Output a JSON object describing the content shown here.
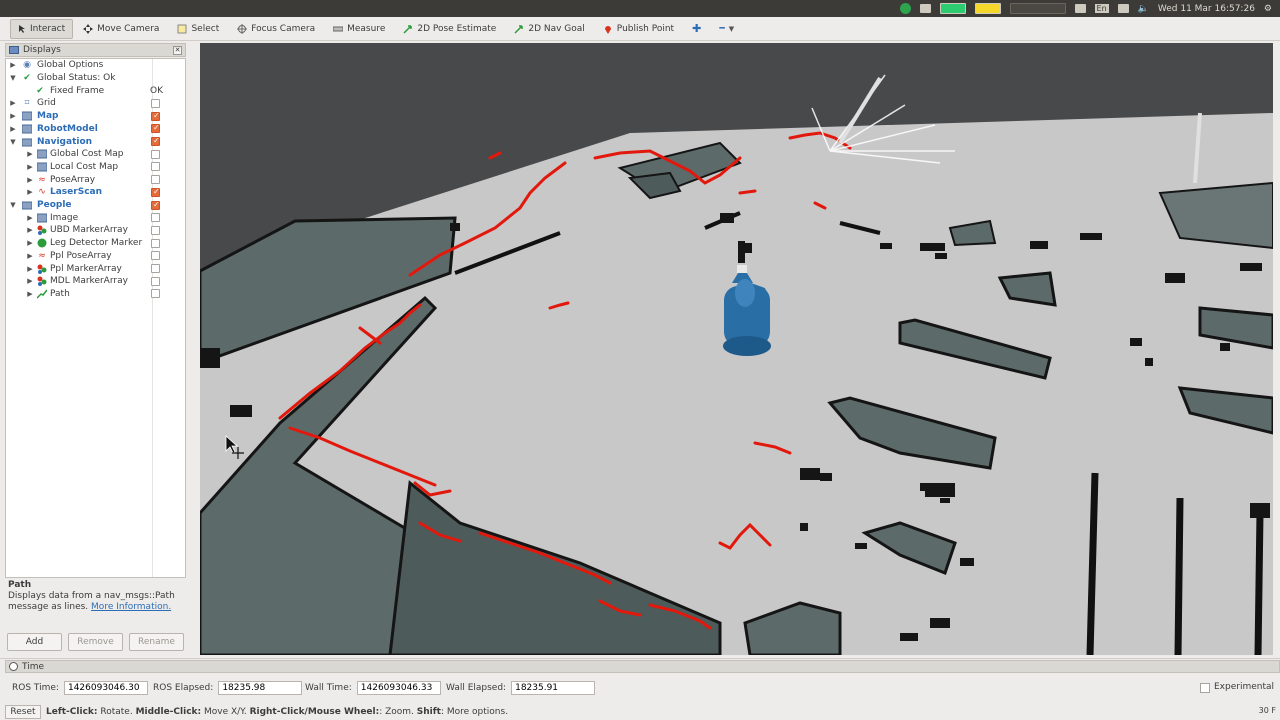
{
  "topbar": {
    "language": "En",
    "clock": "Wed 11 Mar 16:57:26"
  },
  "toolbar": {
    "tools": [
      {
        "label": "Interact",
        "icon": "interact-icon"
      },
      {
        "label": "Move Camera",
        "icon": "move-camera-icon"
      },
      {
        "label": "Select",
        "icon": "select-icon"
      },
      {
        "label": "Focus Camera",
        "icon": "focus-camera-icon"
      },
      {
        "label": "Measure",
        "icon": "measure-icon"
      },
      {
        "label": "2D Pose Estimate",
        "icon": "pose-estimate-icon"
      },
      {
        "label": "2D Nav Goal",
        "icon": "nav-goal-icon"
      },
      {
        "label": "Publish Point",
        "icon": "publish-point-icon"
      }
    ]
  },
  "displays": {
    "title": "Displays",
    "ok_label": "OK",
    "items": [
      {
        "label": "Global Options"
      },
      {
        "label": "Global Status: Ok"
      },
      {
        "label": "Fixed Frame"
      },
      {
        "label": "Grid",
        "checked": false
      },
      {
        "label": "Map",
        "checked": true
      },
      {
        "label": "RobotModel",
        "checked": true
      },
      {
        "label": "Navigation",
        "checked": true
      },
      {
        "label": "Global Cost Map",
        "checked": false
      },
      {
        "label": "Local Cost Map",
        "checked": false
      },
      {
        "label": "PoseArray",
        "checked": false
      },
      {
        "label": "LaserScan",
        "checked": true
      },
      {
        "label": "People",
        "checked": true
      },
      {
        "label": "Image",
        "checked": false
      },
      {
        "label": "UBD MarkerArray",
        "checked": false
      },
      {
        "label": "Leg Detector Marker",
        "checked": false
      },
      {
        "label": "Ppl PoseArray",
        "checked": false
      },
      {
        "label": "Ppl MarkerArray",
        "checked": false
      },
      {
        "label": "MDL MarkerArray",
        "checked": false
      },
      {
        "label": "Path",
        "checked": false
      }
    ]
  },
  "help": {
    "title": "Path",
    "text_line1": "Displays data from a nav_msgs::Path",
    "text_line2": "message as lines.",
    "link": "More Information."
  },
  "buttons": {
    "add": "Add",
    "remove": "Remove",
    "rename": "Rename"
  },
  "time": {
    "title": "Time",
    "ros_time_label": "ROS Time:",
    "ros_time": "1426093046.30",
    "ros_elapsed_label": "ROS Elapsed:",
    "ros_elapsed": "18235.98",
    "wall_time_label": "Wall Time:",
    "wall_time": "1426093046.33",
    "wall_elapsed_label": "Wall Elapsed:",
    "wall_elapsed": "18235.91",
    "experimental_label": "Experimental"
  },
  "status": {
    "reset_label": "Reset",
    "hint_b1": "Left-Click:",
    "hint_t1": " Rotate. ",
    "hint_b2": "Middle-Click:",
    "hint_t2": " Move X/Y. ",
    "hint_b3": "Right-Click/Mouse Wheel:",
    "hint_t3": ": Zoom. ",
    "hint_b4": "Shift",
    "hint_t4": ": More options.",
    "fps": "30 F"
  },
  "colors": {
    "laser": "#e3180c",
    "robot": "#2a6ea6",
    "floor": "#c8c8c8",
    "background": "#48494a",
    "obstacle_gray": "#5d6a6a"
  }
}
